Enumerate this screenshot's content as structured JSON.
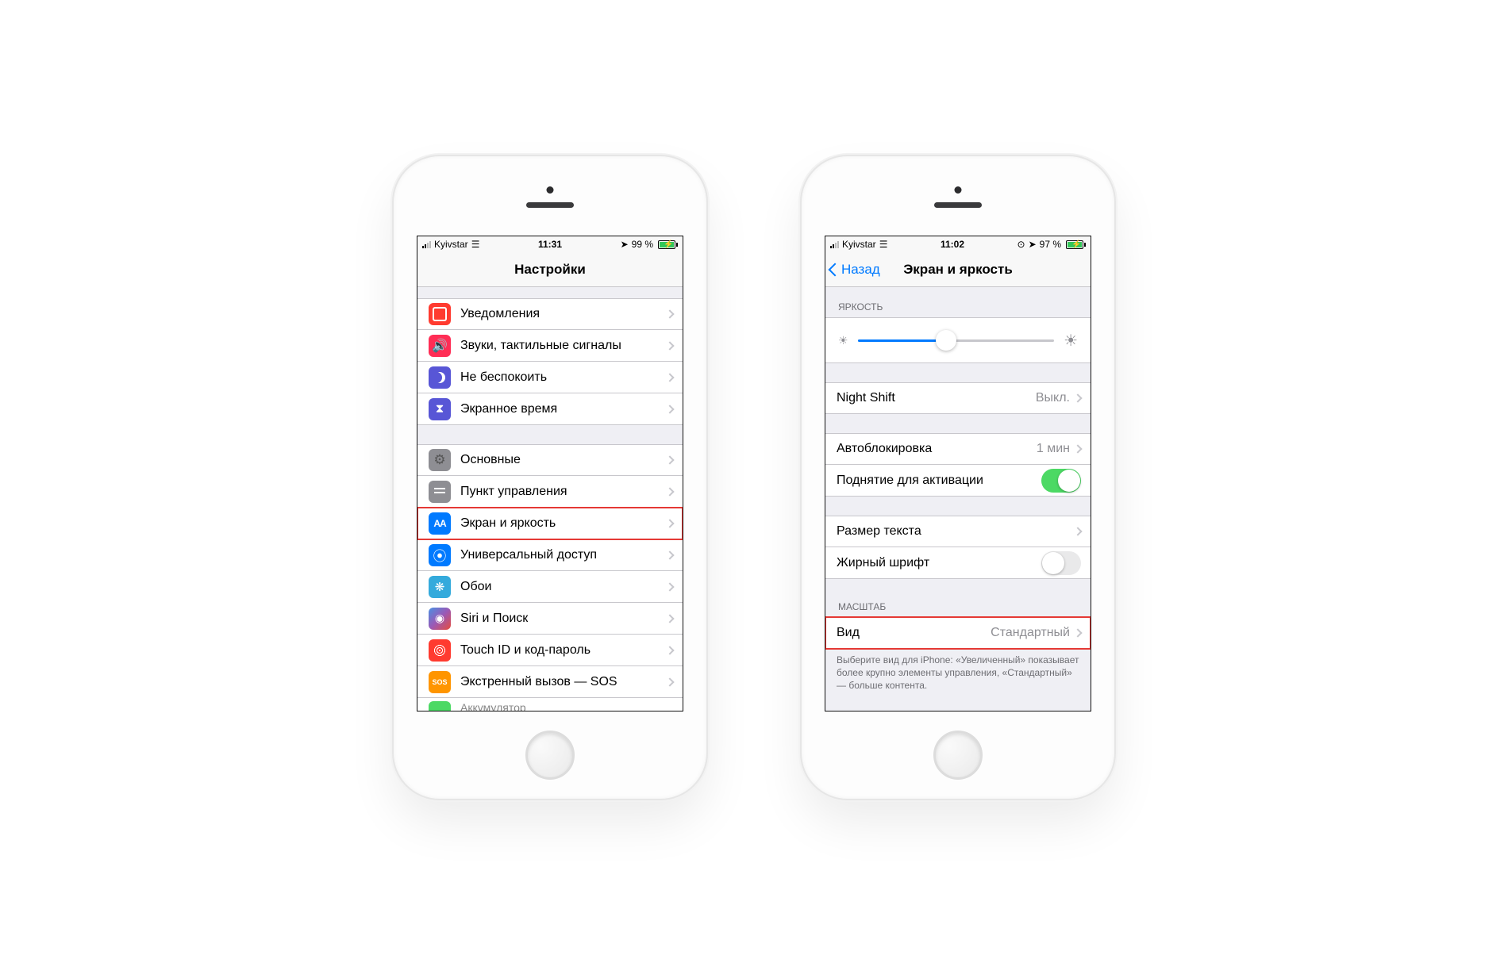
{
  "left": {
    "status": {
      "carrier": "Kyivstar",
      "time": "11:31",
      "battery_percent": "99 %"
    },
    "title": "Настройки",
    "groups": [
      {
        "rows": [
          {
            "icon": "notif",
            "bg": "bg-red",
            "glyph": "",
            "label": "Уведомления"
          },
          {
            "icon": "sound",
            "bg": "bg-pink",
            "glyph": "🔊",
            "label": "Звуки, тактильные сигналы"
          },
          {
            "icon": "moon",
            "bg": "bg-purple",
            "glyph": "",
            "label": "Не беспокоить"
          },
          {
            "icon": "hourglass",
            "bg": "bg-purple",
            "glyph": "⧗",
            "label": "Экранное время"
          }
        ]
      },
      {
        "rows": [
          {
            "icon": "gear",
            "bg": "bg-gray",
            "glyph": "⚙",
            "label": "Основные"
          },
          {
            "icon": "sliders",
            "bg": "bg-gray",
            "glyph": "",
            "label": "Пункт управления"
          },
          {
            "icon": "aa",
            "bg": "bg-blue",
            "glyph": "AA",
            "label": "Экран и яркость",
            "highlight": true
          },
          {
            "icon": "access",
            "bg": "bg-blue",
            "glyph": "⦿",
            "label": "Универсальный доступ"
          },
          {
            "icon": "flower",
            "bg": "bg-teal",
            "glyph": "❋",
            "label": "Обои"
          },
          {
            "icon": "siri",
            "bg": "bg-siri",
            "glyph": "◉",
            "label": "Siri и Поиск"
          },
          {
            "icon": "touchid",
            "bg": "bg-red",
            "glyph": "",
            "label": "Touch ID и код-пароль"
          },
          {
            "icon": "sos",
            "bg": "bg-orange",
            "glyph": "SOS",
            "label": "Экстренный вызов — SOS"
          }
        ]
      }
    ],
    "cutoff_label": "Аккумулятор"
  },
  "right": {
    "status": {
      "carrier": "Kyivstar",
      "time": "11:02",
      "battery_percent": "97 %"
    },
    "back": "Назад",
    "title": "Экран и яркость",
    "brightness_header": "ЯРКОСТЬ",
    "brightness_percent": 45,
    "night_shift_label": "Night Shift",
    "night_shift_value": "Выкл.",
    "auto_lock_label": "Автоблокировка",
    "auto_lock_value": "1 мин",
    "raise_label": "Поднятие для активации",
    "raise_on": true,
    "text_size_label": "Размер текста",
    "bold_label": "Жирный шрифт",
    "bold_on": false,
    "zoom_header": "МАСШТАБ",
    "view_label": "Вид",
    "view_value": "Стандартный",
    "footer": "Выберите вид для iPhone: «Увеличенный» показывает более крупно элементы управления, «Стандартный» — больше контента."
  }
}
